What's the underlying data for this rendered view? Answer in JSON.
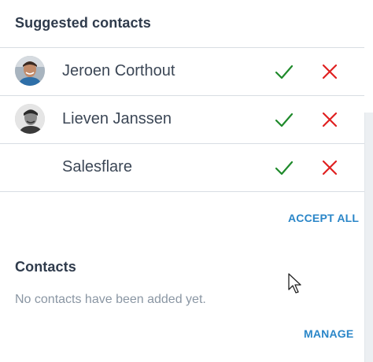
{
  "suggested": {
    "title": "Suggested contacts",
    "contacts": [
      {
        "name": "Jeroen Corthout",
        "avatar_icon": "person-photo-avatar"
      },
      {
        "name": "Lieven Janssen",
        "avatar_icon": "person-photo-avatar"
      },
      {
        "name": "Salesflare",
        "avatar_icon": ""
      }
    ],
    "accept_icon": "check-icon",
    "reject_icon": "close-icon",
    "accept_all_label": "ACCEPT ALL"
  },
  "contacts": {
    "title": "Contacts",
    "empty_message": "No contacts have been added yet.",
    "manage_label": "MANAGE"
  },
  "colors": {
    "accept": "#1f8a2b",
    "reject": "#e02020",
    "link": "#2a86c8",
    "heading": "#2f3b4c",
    "muted": "#8a96a3"
  }
}
